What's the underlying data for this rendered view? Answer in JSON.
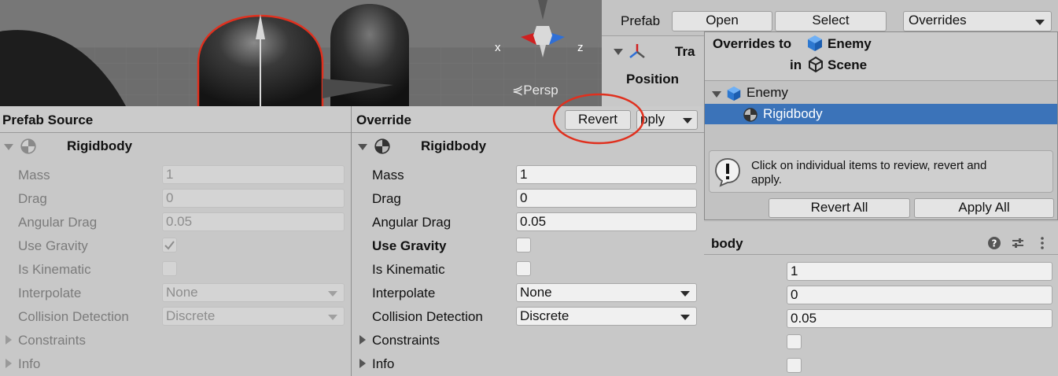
{
  "scene": {
    "gizmo_x": "x",
    "gizmo_z": "z",
    "persp_label": "⋞Persp"
  },
  "prefab_bar": {
    "label": "Prefab",
    "open_label": "Open",
    "select_label": "Select",
    "overrides_label": "Overrides"
  },
  "transform_partial": {
    "title": "Tra",
    "position_label": "Position"
  },
  "overrides_window": {
    "title_prefix": "Overrides to",
    "title_object": "Enemy",
    "title_in": "in",
    "title_scene": "Scene",
    "tree": [
      {
        "label": "Enemy"
      },
      {
        "label": "Rigidbody"
      }
    ],
    "help_text_line1": "Click on individual items to review, revert and",
    "help_text_line2": "apply.",
    "revert_all_label": "Revert All",
    "apply_all_label": "Apply All"
  },
  "prefab_source": {
    "header": "Prefab Source",
    "component_title": "Rigidbody",
    "fields": [
      {
        "label": "Mass",
        "value": "1"
      },
      {
        "label": "Drag",
        "value": "0"
      },
      {
        "label": "Angular Drag",
        "value": "0.05"
      }
    ],
    "use_gravity_label": "Use Gravity",
    "use_gravity_checked": true,
    "is_kinematic_label": "Is Kinematic",
    "interpolate_label": "Interpolate",
    "interpolate_value": "None",
    "collision_label": "Collision Detection",
    "collision_value": "Discrete",
    "constraints_label": "Constraints",
    "info_label": "Info"
  },
  "override": {
    "header": "Override",
    "revert_label": "Revert",
    "apply_label": "pply",
    "component_title": "Rigidbody",
    "fields": [
      {
        "label": "Mass",
        "value": "1"
      },
      {
        "label": "Drag",
        "value": "0"
      },
      {
        "label": "Angular Drag",
        "value": "0.05"
      }
    ],
    "use_gravity_label": "Use Gravity",
    "use_gravity_checked": false,
    "is_kinematic_label": "Is Kinematic",
    "interpolate_label": "Interpolate",
    "interpolate_value": "None",
    "collision_label": "Collision Detection",
    "collision_value": "Discrete",
    "constraints_label": "Constraints",
    "info_label": "Info"
  },
  "inspector_partial": {
    "title": "body",
    "values": [
      "1",
      "0",
      "0.05"
    ]
  },
  "colors": {
    "annotation_red": "#e0301e",
    "selection_blue": "#3b73b9"
  },
  "icons": [
    "foldout-arrow-icon",
    "rigidbody-icon",
    "prefab-cube-icon",
    "unity-scene-icon",
    "transform-icon",
    "help-icon",
    "presets-icon",
    "kebab-menu-icon",
    "info-icon",
    "checkmark-icon"
  ]
}
